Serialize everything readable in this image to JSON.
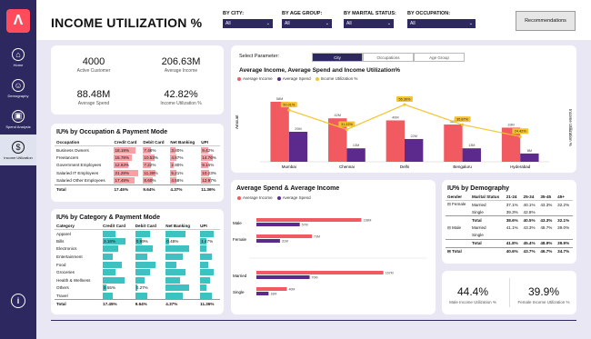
{
  "header": {
    "title": "INCOME UTILIZATION %",
    "recommend": "Recommendations"
  },
  "filters": [
    {
      "label": "BY CITY:",
      "value": "All"
    },
    {
      "label": "BY AGE GROUP:",
      "value": "All"
    },
    {
      "label": "BY MARITAL STATUS:",
      "value": "All"
    },
    {
      "label": "BY OCCUPATION:",
      "value": "All"
    }
  ],
  "nav": [
    {
      "label": "Home",
      "icon": "home-icon"
    },
    {
      "label": "Demography",
      "icon": "people-icon"
    },
    {
      "label": "Spend Analysis",
      "icon": "wallet-icon"
    },
    {
      "label": "Income Utilization",
      "icon": "money-bag-icon"
    }
  ],
  "kpis": [
    {
      "value": "4000",
      "label": "Active Customer"
    },
    {
      "value": "206.63M",
      "label": "Average Income"
    },
    {
      "value": "88.48M",
      "label": "Average Spend"
    },
    {
      "value": "42.82%",
      "label": "Income Utilization %"
    }
  ],
  "occupation": {
    "title": "IU% by Occupation & Payment Mode",
    "headers": [
      "Occupation",
      "Credit Card",
      "Debit Card",
      "Net Banking",
      "UPI"
    ],
    "rows": [
      [
        "Business Owners",
        "18.19%",
        "7.46%",
        "3.80%",
        "9.42%"
      ],
      [
        "Freelancers",
        "15.78%",
        "10.53%",
        "4.67%",
        "14.76%"
      ],
      [
        "Government Employees",
        "12.63%",
        "7.22%",
        "2.80%",
        "9.16%"
      ],
      [
        "Salaried IT Employees",
        "21.28%",
        "11.28%",
        "5.21%",
        "10.23%"
      ],
      [
        "Salaried Other Employees",
        "17.49%",
        "8.60%",
        "4.58%",
        "12.97%"
      ]
    ],
    "total": [
      "Total",
      "17.45%",
      "9.64%",
      "4.37%",
      "11.36%"
    ]
  },
  "category": {
    "title": "IU% by Category & Payment Mode",
    "headers": [
      "Category",
      "Credit Card",
      "Debit Card",
      "Net Banking",
      "UPI"
    ],
    "rows": [
      [
        "Apparel",
        "",
        "",
        "",
        ""
      ],
      [
        "Bills",
        "3.18%",
        "0.99%",
        "0.48%",
        "1.47%"
      ],
      [
        "Electronics",
        "",
        "",
        "",
        ""
      ],
      [
        "Entertainment",
        "",
        "",
        "",
        ""
      ],
      [
        "Food",
        "",
        "",
        "",
        ""
      ],
      [
        "Groceries",
        "",
        "",
        "",
        ""
      ],
      [
        "Health & Wellness",
        "",
        "",
        "",
        ""
      ],
      [
        "Others",
        "0.55%",
        "0.27%",
        "",
        ""
      ],
      [
        "Travel",
        "",
        "",
        "",
        ""
      ]
    ],
    "total": [
      "Total",
      "17.45%",
      "9.64%",
      "4.37%",
      "11.36%"
    ]
  },
  "main_chart": {
    "select_label": "Select Parameter:",
    "tabs": [
      "City",
      "Occupations",
      "Age Group"
    ],
    "title": "Average Income, Average Spend and Income Utilization%",
    "legend": [
      "Average Income",
      "Average Spend",
      "Income Utilization %"
    ],
    "ylabel": "Amount",
    "y2label": "Income Utilization %"
  },
  "chart_data": [
    {
      "type": "bar",
      "title": "Average Income, Average Spend and Income Utilization%",
      "categories": [
        "Mumbai",
        "Chennai",
        "Delhi",
        "Bengaluru",
        "Hyderabad"
      ],
      "series": [
        {
          "name": "Average Income",
          "values": [
            58,
            42,
            40,
            36,
            33
          ]
        },
        {
          "name": "Average Spend",
          "values": [
            29,
            13,
            22,
            13,
            8
          ]
        },
        {
          "name": "Income Utilization %",
          "values": [
            50.01,
            31.22,
            55.3,
            35.87,
            24.42
          ]
        }
      ],
      "ylabel": "Amount",
      "y2label": "Income Utilization %",
      "data_labels": {
        "income": [
          "58M",
          "42M",
          "40M",
          "36M",
          "33M"
        ],
        "spend": [
          "29M",
          "13M",
          "22M",
          "13M",
          "8M"
        ],
        "iu": [
          "50.01%",
          "31.22%",
          "55.30%",
          "35.87%",
          "24.42%"
        ]
      }
    },
    {
      "type": "bar",
      "title": "Average Spend & Average Income",
      "categories": [
        "Male",
        "Female",
        "Married",
        "Single"
      ],
      "series": [
        {
          "name": "Average Income",
          "values": [
            138,
            73,
            167,
            40
          ]
        },
        {
          "name": "Average Spend",
          "values": [
            57,
            31,
            70,
            16
          ]
        }
      ],
      "data_labels": {
        "income": [
          "138M",
          "73M",
          "167M",
          "40M"
        ],
        "spend": [
          "57M",
          "31M",
          "70M",
          "16M"
        ]
      }
    }
  ],
  "spend_chart": {
    "title": "Average Spend & Average Income",
    "legend": [
      "Average Income",
      "Average Spend"
    ]
  },
  "demography": {
    "title": "IU% by Demography",
    "headers": [
      "Gender",
      "Marital Status",
      "21-24",
      "25-34",
      "35-45",
      "45+"
    ],
    "rows": [
      [
        "Female",
        "Married",
        "37.1%",
        "40.1%",
        "43.3%",
        "32.2%"
      ],
      [
        "",
        "Single",
        "39.3%",
        "42.8%",
        "",
        ""
      ],
      [
        "",
        "Total",
        "38.6%",
        "40.5%",
        "43.3%",
        "32.1%"
      ],
      [
        "Male",
        "Married",
        "41.1%",
        "43.3%",
        "48.7%",
        "39.0%"
      ],
      [
        "",
        "Single",
        "",
        "",
        "",
        ""
      ],
      [
        "",
        "Total",
        "41.8%",
        "45.4%",
        "48.9%",
        "39.9%"
      ],
      [
        "Total",
        "",
        "40.6%",
        "43.7%",
        "46.7%",
        "34.7%"
      ]
    ]
  },
  "gender_iu": [
    {
      "value": "44.4%",
      "label": "Male Income Utilization %"
    },
    {
      "value": "39.9%",
      "label": "Female Income Utilization %"
    }
  ],
  "colors": {
    "income": "#f25a61",
    "spend": "#5b2a8c",
    "iu": "#f7c431",
    "navy": "#2d2860",
    "teal": "#3ec1c1"
  }
}
